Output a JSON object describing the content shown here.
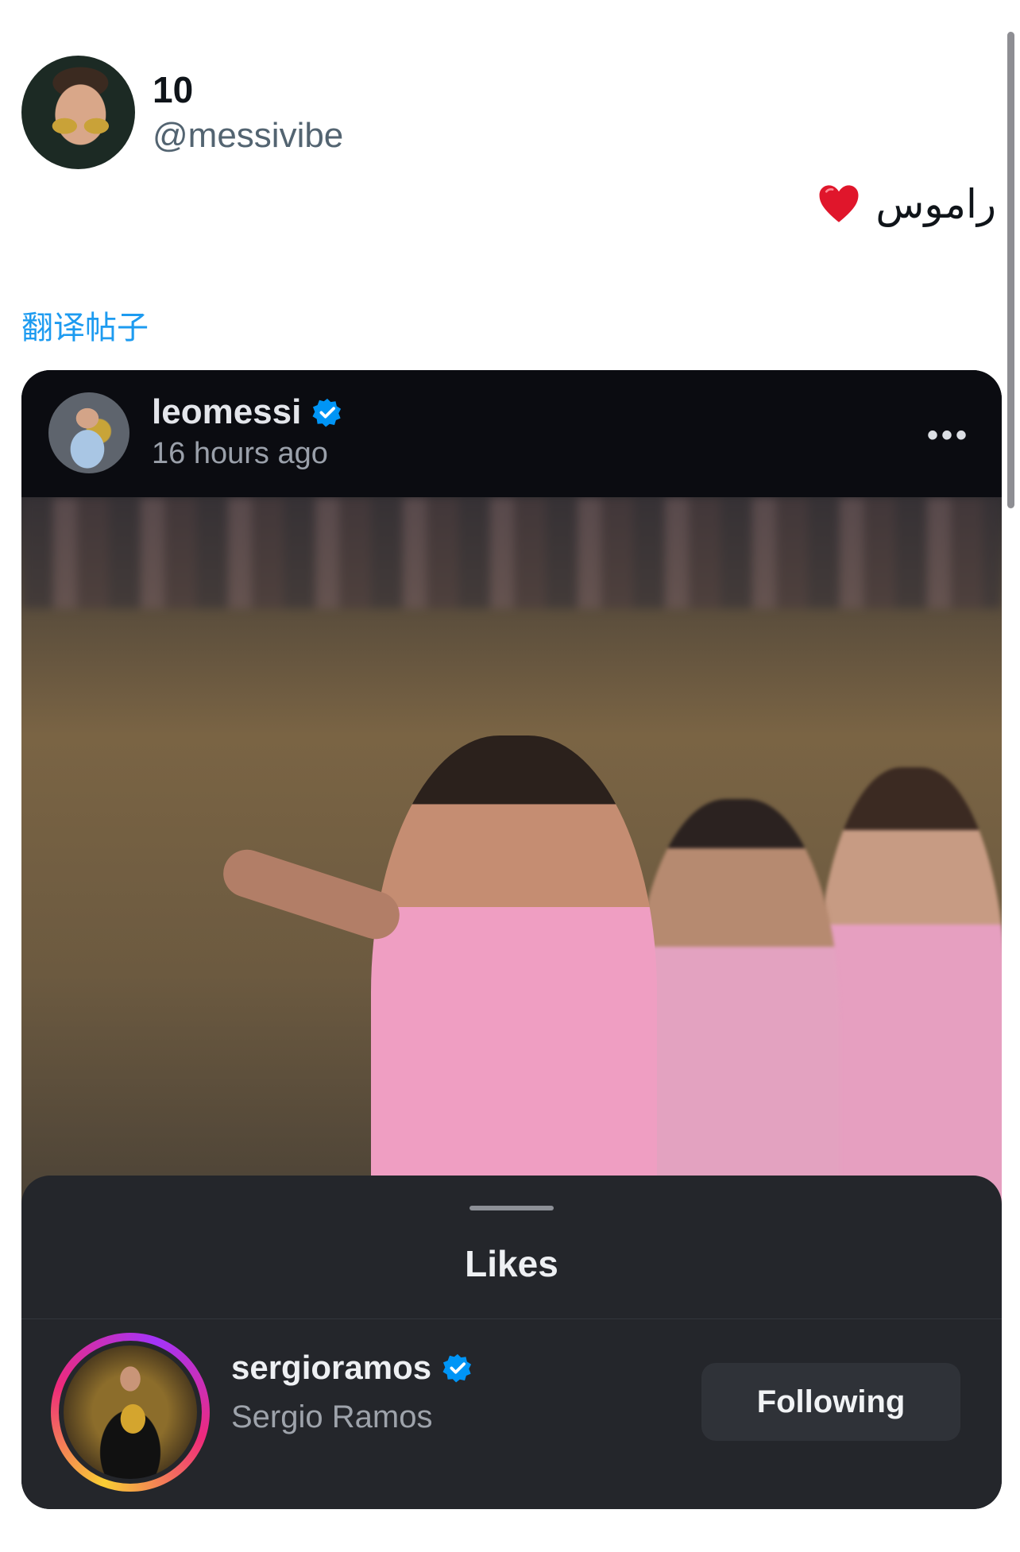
{
  "tweet": {
    "display_name": "10",
    "handle": "@messivibe",
    "text": "راموس",
    "translate_label": "翻译帖子"
  },
  "embedded_post": {
    "username": "leomessi",
    "time": "16 hours ago",
    "more_label": "•••"
  },
  "likes_sheet": {
    "title": "Likes",
    "user": {
      "username": "sergioramos",
      "full_name": "Sergio Ramos",
      "button_label": "Following"
    }
  },
  "colors": {
    "verified": "#0095f6",
    "link": "#1d9bf0",
    "heart": "#e0162b"
  }
}
